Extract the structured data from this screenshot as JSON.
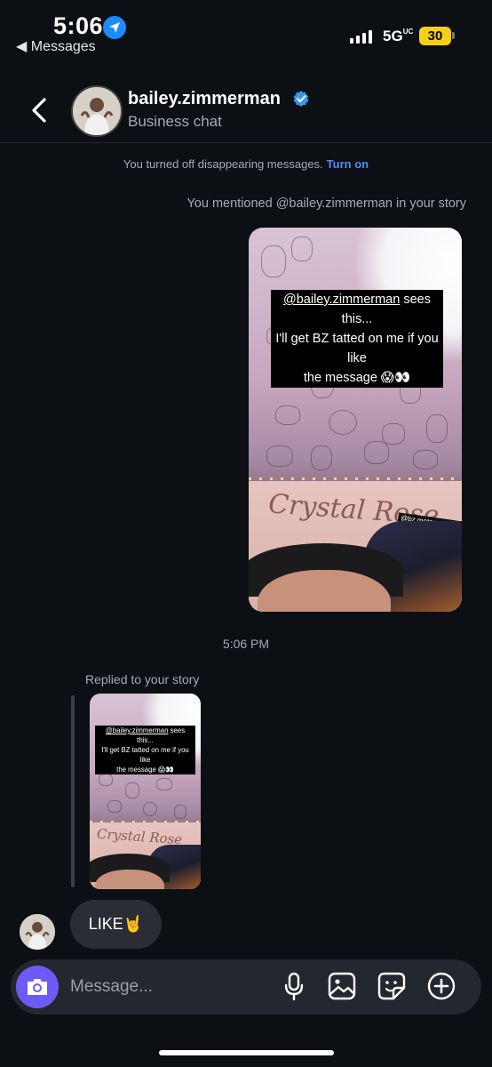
{
  "status_bar": {
    "time": "5:06",
    "back_app": "◀ Messages",
    "network": "5G",
    "network_suffix": "UC",
    "battery": "30",
    "battery_color": "#f5d016"
  },
  "header": {
    "username": "bailey.zimmerman",
    "subtitle": "Business chat",
    "verified": true
  },
  "notice": {
    "text": "You turned off disappearing messages.",
    "link": "Turn on"
  },
  "mention": "You mentioned @bailey.zimmerman in your story",
  "story": {
    "caption_handle": "@bailey.zimmerman",
    "caption_line1_rest": " sees this...",
    "caption_line2": "I'll get BZ tatted on me if you like",
    "caption_line3": "the message 😱👀",
    "sign_text": "Crystal Rose",
    "tag_text": "@bz motorsports"
  },
  "timestamp": "5:06 PM",
  "reply_label": "Replied to your story",
  "message": "LIKE🤘",
  "composer": {
    "placeholder": "Message...",
    "icons": [
      "camera-icon",
      "microphone-icon",
      "gallery-icon",
      "sticker-icon",
      "plus-icon"
    ]
  },
  "colors": {
    "background": "#0c0f14",
    "link": "#4f8ef7",
    "camera_button": "#6c5cf5",
    "bubble": "#2a2d33",
    "verified": "#3897f0"
  }
}
